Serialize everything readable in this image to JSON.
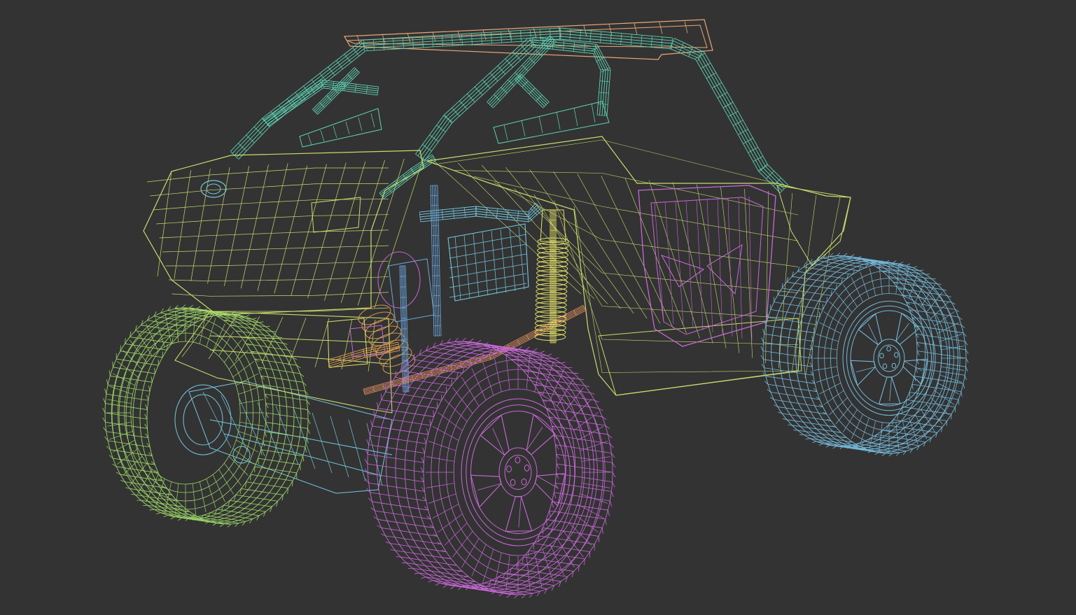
{
  "viewport": {
    "background": "#333333"
  },
  "model": {
    "colors": {
      "roll_cage": "#5ed3b4",
      "body": "#c8dc6e",
      "roof": "#e8a878",
      "rear_left_wheel": "#9ad466",
      "front_left_wheel": "#c868d8",
      "front_right_wheel": "#74b8d8",
      "door": "#c868d8",
      "shock": "#e2e068",
      "chassis": "#74c8e0",
      "axle": "#e09060",
      "exhaust": "#e0a050",
      "engine_block": "#6aa8e0"
    }
  }
}
